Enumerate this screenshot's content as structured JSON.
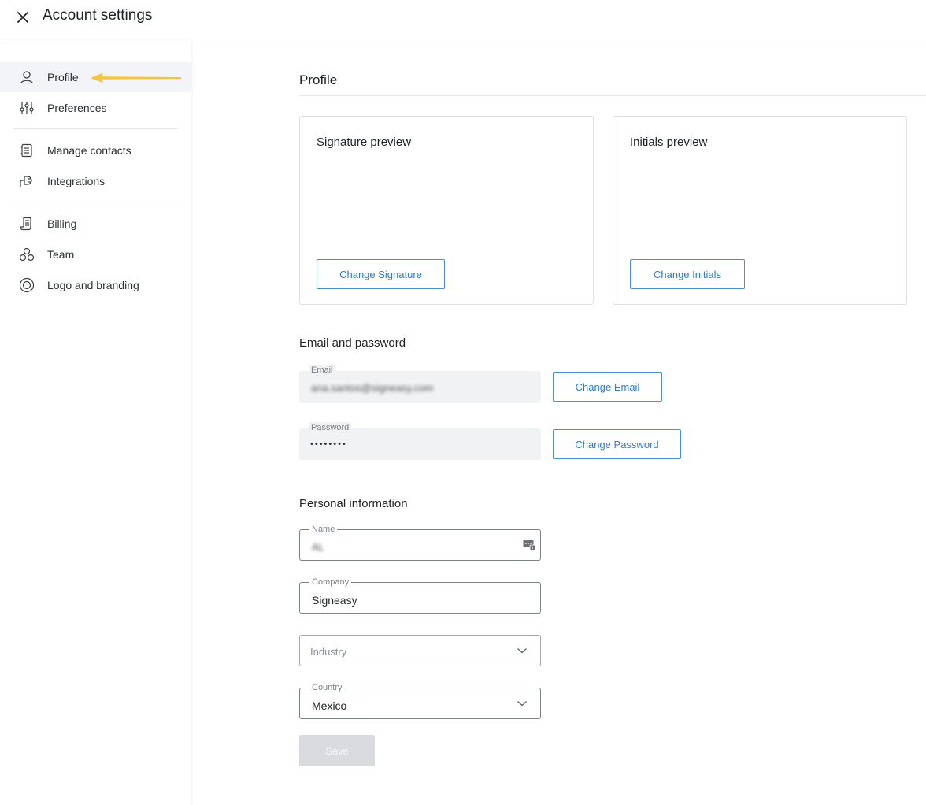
{
  "header": {
    "title": "Account settings",
    "close_icon": "close-icon"
  },
  "sidebar": {
    "items": [
      {
        "label": "Profile",
        "icon": "user-icon",
        "active": true
      },
      {
        "label": "Preferences",
        "icon": "sliders-icon"
      },
      {
        "label": "Manage contacts",
        "icon": "contacts-book-icon"
      },
      {
        "label": "Integrations",
        "icon": "plug-icon"
      },
      {
        "label": "Billing",
        "icon": "receipt-icon"
      },
      {
        "label": "Team",
        "icon": "team-icon"
      },
      {
        "label": "Logo and branding",
        "icon": "branding-circle-icon"
      }
    ]
  },
  "main": {
    "title": "Profile",
    "signature_card": {
      "title": "Signature preview",
      "button": "Change Signature"
    },
    "initials_card": {
      "title": "Initials preview",
      "button": "Change Initials"
    },
    "email_password": {
      "heading": "Email and password",
      "email_label": "Email",
      "email_value": "ana.santos@signeasy.com",
      "email_button": "Change Email",
      "password_label": "Password",
      "password_value": "••••••••",
      "password_button": "Change Password"
    },
    "personal": {
      "heading": "Personal information",
      "name_label": "Name",
      "name_value": "AL",
      "company_label": "Company",
      "company_value": "Signeasy",
      "industry_placeholder": "Industry",
      "country_label": "Country",
      "country_value": "Mexico"
    },
    "save_button": "Save"
  },
  "colors": {
    "accent": "#2e7bcf",
    "pointer_arrow": "#f5c342",
    "active_bg": "#f2f4f7"
  }
}
